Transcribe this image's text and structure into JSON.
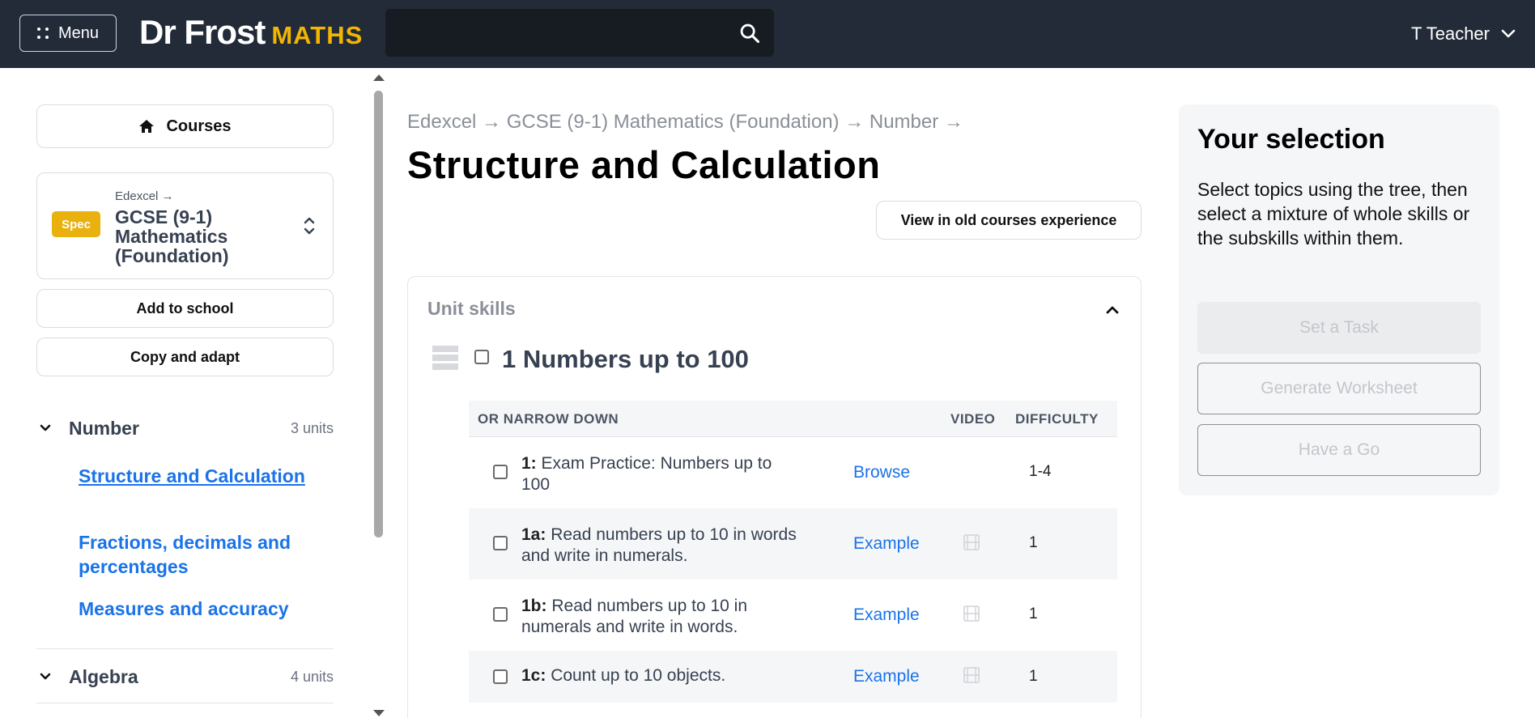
{
  "topbar": {
    "menu_label": "Menu",
    "logo_main": "Dr Frost",
    "logo_accent": "MATHS",
    "search_placeholder": "",
    "user_name": "T Teacher"
  },
  "sidebar": {
    "courses_label": "Courses",
    "spec": {
      "badge": "Spec",
      "crumb": "Edexcel →",
      "title": "GCSE (9-1) Mathematics (Foundation)"
    },
    "add_to_school": "Add to school",
    "copy_and_adapt": "Copy and adapt",
    "tree": [
      {
        "label": "Number",
        "count": "3 units",
        "items": [
          {
            "label": "Structure and Calculation",
            "active": true
          },
          {
            "label": "Fractions, decimals and percentages",
            "active": false
          },
          {
            "label": "Measures and accuracy",
            "active": false
          }
        ]
      },
      {
        "label": "Algebra",
        "count": "4 units",
        "items": []
      }
    ]
  },
  "main": {
    "breadcrumb": "Edexcel → GCSE (9-1) Mathematics (Foundation) → Number →",
    "title": "Structure and Calculation",
    "old_experience": "View in old courses experience",
    "unit_skills_label": "Unit skills",
    "skill": {
      "title": "1 Numbers up to 100"
    },
    "table": {
      "headers": {
        "narrow": "OR NARROW DOWN",
        "video": "VIDEO",
        "difficulty": "DIFFICULTY"
      },
      "rows": [
        {
          "code": "1:",
          "text": "Exam Practice: Numbers up to 100",
          "link": "Browse",
          "video": false,
          "difficulty": "1-4"
        },
        {
          "code": "1a:",
          "text": "Read numbers up to 10 in words and write in numerals.",
          "link": "Example",
          "video": true,
          "difficulty": "1"
        },
        {
          "code": "1b:",
          "text": "Read numbers up to 10 in numerals and write in words.",
          "link": "Example",
          "video": true,
          "difficulty": "1"
        },
        {
          "code": "1c:",
          "text": "Count up to 10 objects.",
          "link": "Example",
          "video": true,
          "difficulty": "1"
        }
      ]
    }
  },
  "selection": {
    "title": "Your selection",
    "description": "Select topics using the tree, then select a mixture of whole skills or the subskills within them.",
    "set_task": "Set a Task",
    "generate_worksheet": "Generate Worksheet",
    "have_a_go": "Have a Go"
  },
  "colors": {
    "topbar_bg": "#232b38",
    "logo_accent": "#f2b600",
    "link_blue": "#1a73e8",
    "spec_badge": "#e9b10d"
  },
  "icons": {
    "menu": "grid-dots-icon",
    "search": "search-icon",
    "user_chevron": "chevron-down-icon",
    "courses": "home-icon",
    "spec_toggle": "chevron-up-down-icon",
    "tree_chevron": "chevron-down-icon",
    "collapse": "chevron-up-icon",
    "drag": "drag-handle-icon",
    "video": "film-icon"
  }
}
